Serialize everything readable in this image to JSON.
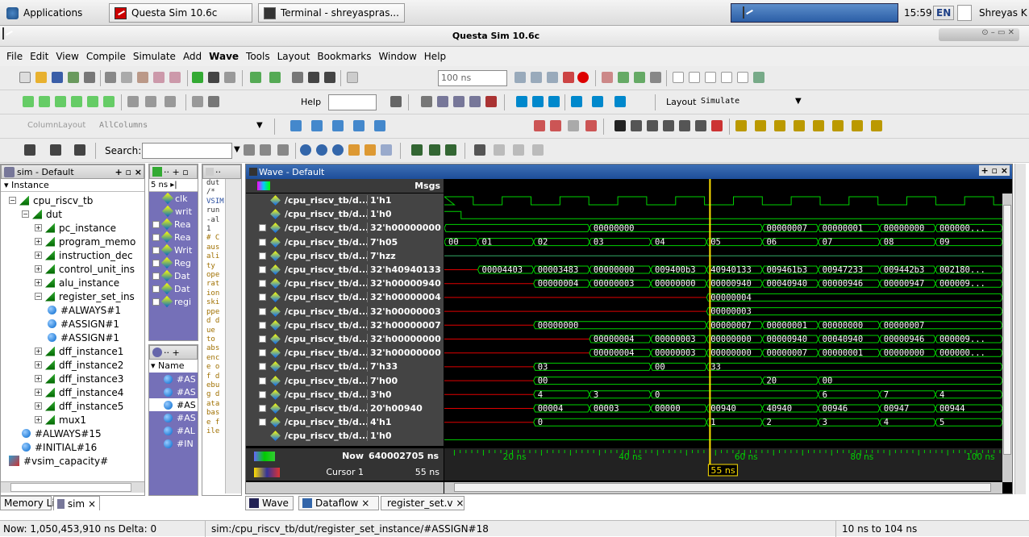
{
  "taskbar": {
    "applications": "Applications",
    "task1": "Questa Sim 10.6c",
    "task2": "Terminal - shreyaspras...",
    "clock": "15:59",
    "lang": "EN",
    "user": "Shreyas K"
  },
  "window": {
    "title": "Questa Sim 10.6c"
  },
  "menu": [
    "File",
    "Edit",
    "View",
    "Compile",
    "Simulate",
    "Add",
    "Wave",
    "Tools",
    "Layout",
    "Bookmarks",
    "Window",
    "Help"
  ],
  "toolbar": {
    "time_field": "100 ns",
    "help_label": "Help",
    "layout_label": "Layout",
    "layout_value": "Simulate",
    "column_layout_label": "ColumnLayout",
    "column_layout_value": "AllColumns",
    "search_label": "Search:"
  },
  "sim_pane": {
    "title": "sim - Default",
    "header": "Instance",
    "items": [
      {
        "label": "cpu_riscv_tb",
        "indent": 0,
        "type": "mod"
      },
      {
        "label": "dut",
        "indent": 1,
        "type": "mod"
      },
      {
        "label": "pc_instance",
        "indent": 2,
        "type": "mod"
      },
      {
        "label": "program_memo",
        "indent": 2,
        "type": "mod"
      },
      {
        "label": "instruction_dec",
        "indent": 2,
        "type": "mod"
      },
      {
        "label": "control_unit_ins",
        "indent": 2,
        "type": "mod"
      },
      {
        "label": "alu_instance",
        "indent": 2,
        "type": "mod"
      },
      {
        "label": "register_set_ins",
        "indent": 2,
        "type": "mod"
      },
      {
        "label": "#ALWAYS#1",
        "indent": 3,
        "type": "proc"
      },
      {
        "label": "#ASSIGN#1",
        "indent": 3,
        "type": "proc"
      },
      {
        "label": "#ASSIGN#1",
        "indent": 3,
        "type": "proc"
      },
      {
        "label": "dff_instance1",
        "indent": 2,
        "type": "mod"
      },
      {
        "label": "dff_instance2",
        "indent": 2,
        "type": "mod"
      },
      {
        "label": "dff_instance3",
        "indent": 2,
        "type": "mod"
      },
      {
        "label": "dff_instance4",
        "indent": 2,
        "type": "mod"
      },
      {
        "label": "dff_instance5",
        "indent": 2,
        "type": "mod"
      },
      {
        "label": "mux1",
        "indent": 2,
        "type": "mod"
      },
      {
        "label": "#ALWAYS#15",
        "indent": 1,
        "type": "proc"
      },
      {
        "label": "#INITIAL#16",
        "indent": 1,
        "type": "proc"
      },
      {
        "label": "#vsim_capacity#",
        "indent": 0,
        "type": "cap"
      }
    ]
  },
  "objects_pane": {
    "time": "5 ns",
    "items": [
      "clk",
      "writ",
      "Rea",
      "Rea",
      "Writ",
      "Reg",
      "Dat",
      "Dat",
      "regi"
    ]
  },
  "process_pane": {
    "header": "Name",
    "items": [
      "#AS",
      "#AS",
      "#AS",
      "#AS",
      "#AL",
      "#IN"
    ]
  },
  "transcript_pane": {
    "lines": [
      "dut",
      "/*",
      "VSIM",
      "run",
      "-al",
      "1",
      "# C",
      "aus",
      "ali",
      "ty",
      "ope",
      "rat",
      "ion",
      "ski",
      "ppe",
      "d d",
      "ue",
      "to",
      "abs",
      "enc",
      "e o",
      "f d",
      "ebu",
      "g d",
      "ata",
      "bas",
      "e f",
      "ile"
    ]
  },
  "wave": {
    "title": "Wave - Default",
    "msgs_label": "Msgs",
    "signals": [
      {
        "name": "/cpu_riscv_tb/d...",
        "value": "1'h1",
        "expand": false
      },
      {
        "name": "/cpu_riscv_tb/d...",
        "value": "1'h0",
        "expand": false
      },
      {
        "name": "/cpu_riscv_tb/d...",
        "value": "32'h00000000",
        "expand": true
      },
      {
        "name": "/cpu_riscv_tb/d...",
        "value": "7'h05",
        "expand": true
      },
      {
        "name": "/cpu_riscv_tb/d...",
        "value": "7'hzz",
        "expand": true
      },
      {
        "name": "/cpu_riscv_tb/d...",
        "value": "32'h40940133",
        "expand": true
      },
      {
        "name": "/cpu_riscv_tb/d...",
        "value": "32'h00000940",
        "expand": true
      },
      {
        "name": "/cpu_riscv_tb/d...",
        "value": "32'h00000004",
        "expand": true
      },
      {
        "name": "/cpu_riscv_tb/d...",
        "value": "32'h00000003",
        "expand": true
      },
      {
        "name": "/cpu_riscv_tb/d...",
        "value": "32'h00000007",
        "expand": true
      },
      {
        "name": "/cpu_riscv_tb/d...",
        "value": "32'h00000000",
        "expand": true
      },
      {
        "name": "/cpu_riscv_tb/d...",
        "value": "32'h00000000",
        "expand": true
      },
      {
        "name": "/cpu_riscv_tb/d...",
        "value": "7'h33",
        "expand": true
      },
      {
        "name": "/cpu_riscv_tb/d...",
        "value": "7'h00",
        "expand": true
      },
      {
        "name": "/cpu_riscv_tb/d...",
        "value": "3'h0",
        "expand": true
      },
      {
        "name": "/cpu_riscv_tb/d...",
        "value": "20'h00940",
        "expand": true
      },
      {
        "name": "/cpu_riscv_tb/d...",
        "value": "4'h1",
        "expand": true
      },
      {
        "name": "/cpu_riscv_tb/d...",
        "value": "1'h0",
        "expand": false
      }
    ],
    "now_label": "Now",
    "now_value": "640002705 ns",
    "cursor_label": "Cursor 1",
    "cursor_value": "55 ns",
    "cursor_tag": "55 ns",
    "timeline": [
      "20 ns",
      "40 ns",
      "60 ns",
      "80 ns",
      "100 ns"
    ],
    "buses": [
      [
        {
          "t": 0.0,
          "v": ""
        },
        {
          "t": 0.26,
          "v": "00000000"
        },
        {
          "t": 0.57,
          "v": "00000007"
        },
        {
          "t": 0.67,
          "v": "00000001"
        },
        {
          "t": 0.78,
          "v": "00000000"
        },
        {
          "t": 0.88,
          "v": "000000..."
        }
      ],
      [
        {
          "t": 0.0,
          "v": "00"
        },
        {
          "t": 0.06,
          "v": "01"
        },
        {
          "t": 0.16,
          "v": "02"
        },
        {
          "t": 0.26,
          "v": "03"
        },
        {
          "t": 0.37,
          "v": "04"
        },
        {
          "t": 0.47,
          "v": "05"
        },
        {
          "t": 0.57,
          "v": "06"
        },
        {
          "t": 0.67,
          "v": "07"
        },
        {
          "t": 0.78,
          "v": "08"
        },
        {
          "t": 0.88,
          "v": "09"
        }
      ],
      [],
      [
        {
          "t": 0.06,
          "v": "00004403"
        },
        {
          "t": 0.16,
          "v": "00003483"
        },
        {
          "t": 0.26,
          "v": "00000000"
        },
        {
          "t": 0.37,
          "v": "009400b3"
        },
        {
          "t": 0.47,
          "v": "40940133"
        },
        {
          "t": 0.57,
          "v": "009461b3"
        },
        {
          "t": 0.67,
          "v": "00947233"
        },
        {
          "t": 0.78,
          "v": "009442b3"
        },
        {
          "t": 0.88,
          "v": "002180..."
        }
      ],
      [
        {
          "t": 0.16,
          "v": "00000004"
        },
        {
          "t": 0.26,
          "v": "00000003"
        },
        {
          "t": 0.37,
          "v": "00000000"
        },
        {
          "t": 0.47,
          "v": "00000940"
        },
        {
          "t": 0.57,
          "v": "00040940"
        },
        {
          "t": 0.67,
          "v": "00000946"
        },
        {
          "t": 0.78,
          "v": "00000947"
        },
        {
          "t": 0.88,
          "v": "000009..."
        }
      ],
      [
        {
          "t": 0.47,
          "v": "00000004"
        }
      ],
      [
        {
          "t": 0.47,
          "v": "00000003"
        }
      ],
      [
        {
          "t": 0.16,
          "v": "00000000"
        },
        {
          "t": 0.47,
          "v": "00000007"
        },
        {
          "t": 0.57,
          "v": "00000001"
        },
        {
          "t": 0.67,
          "v": "00000000"
        },
        {
          "t": 0.78,
          "v": "00000007"
        }
      ],
      [
        {
          "t": 0.26,
          "v": "00000004"
        },
        {
          "t": 0.37,
          "v": "00000003"
        },
        {
          "t": 0.47,
          "v": "00000000"
        },
        {
          "t": 0.57,
          "v": "00000940"
        },
        {
          "t": 0.67,
          "v": "00040940"
        },
        {
          "t": 0.78,
          "v": "00000946"
        },
        {
          "t": 0.88,
          "v": "000009..."
        }
      ],
      [
        {
          "t": 0.26,
          "v": "00000004"
        },
        {
          "t": 0.37,
          "v": "00000003"
        },
        {
          "t": 0.47,
          "v": "00000000"
        },
        {
          "t": 0.57,
          "v": "00000007"
        },
        {
          "t": 0.67,
          "v": "00000001"
        },
        {
          "t": 0.78,
          "v": "00000000"
        },
        {
          "t": 0.88,
          "v": "000000..."
        }
      ],
      [
        {
          "t": 0.16,
          "v": "03"
        },
        {
          "t": 0.37,
          "v": "00"
        },
        {
          "t": 0.47,
          "v": "33"
        }
      ],
      [
        {
          "t": 0.16,
          "v": "00"
        },
        {
          "t": 0.57,
          "v": "20"
        },
        {
          "t": 0.67,
          "v": "00"
        }
      ],
      [
        {
          "t": 0.16,
          "v": "4"
        },
        {
          "t": 0.26,
          "v": "3"
        },
        {
          "t": 0.37,
          "v": "0"
        },
        {
          "t": 0.67,
          "v": "6"
        },
        {
          "t": 0.78,
          "v": "7"
        },
        {
          "t": 0.88,
          "v": "4"
        }
      ],
      [
        {
          "t": 0.16,
          "v": "00004"
        },
        {
          "t": 0.26,
          "v": "00003"
        },
        {
          "t": 0.37,
          "v": "00000"
        },
        {
          "t": 0.47,
          "v": "00940"
        },
        {
          "t": 0.57,
          "v": "40940"
        },
        {
          "t": 0.67,
          "v": "00946"
        },
        {
          "t": 0.78,
          "v": "00947"
        },
        {
          "t": 0.88,
          "v": "00944"
        }
      ],
      [
        {
          "t": 0.16,
          "v": "0"
        },
        {
          "t": 0.47,
          "v": "1"
        },
        {
          "t": 0.57,
          "v": "2"
        },
        {
          "t": 0.67,
          "v": "3"
        },
        {
          "t": 0.78,
          "v": "4"
        },
        {
          "t": 0.88,
          "v": "5"
        }
      ]
    ]
  },
  "tabs": {
    "memory": "Memory List",
    "sim": "sim",
    "wave": "Wave",
    "dataflow": "Dataflow",
    "register": "register_set.v"
  },
  "status": {
    "now": "Now: 1,050,453,910 ns  Delta: 0",
    "path": "sim:/cpu_riscv_tb/dut/register_set_instance/#ASSIGN#18",
    "range": "10 ns to 104 ns"
  },
  "colors": {
    "wave_green": "#00d200",
    "cursor": "#ffe000",
    "bus_red": "#e00000"
  }
}
